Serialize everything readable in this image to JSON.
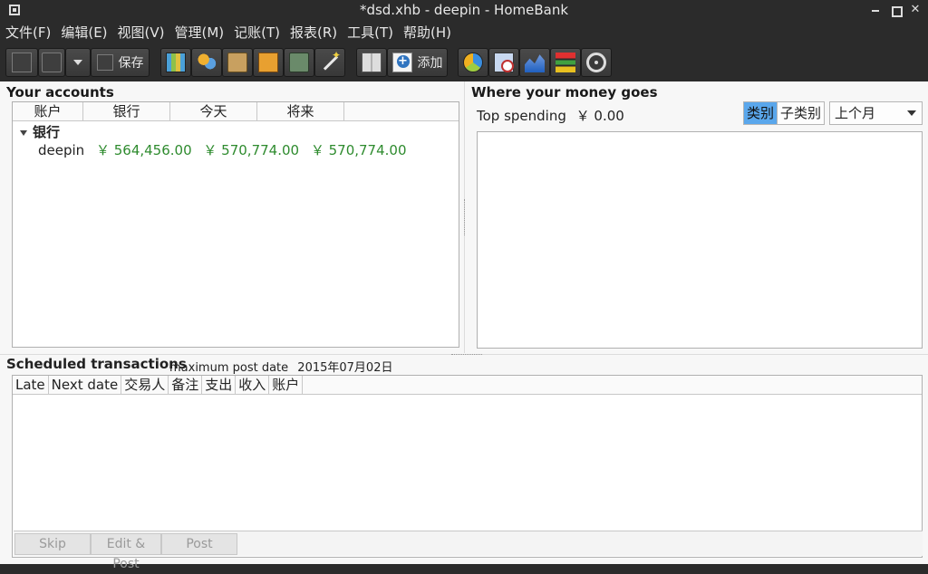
{
  "window": {
    "title": "*dsd.xhb - deepin - HomeBank"
  },
  "menu": [
    "文件(F)",
    "编辑(E)",
    "视图(V)",
    "管理(M)",
    "记账(T)",
    "报表(R)",
    "工具(T)",
    "帮助(H)"
  ],
  "toolbar": {
    "save_label": "保存",
    "add_label": "添加",
    "icons": [
      "new-file-icon",
      "open-folder-icon",
      "dropdown-arrow-icon",
      "save-icon",
      "accounts-icon",
      "payees-icon",
      "categories-icon",
      "budget-icon",
      "archives-icon",
      "wand-icon",
      "ledger-icon",
      "add-transaction-icon",
      "pie-report-icon",
      "balance-report-icon",
      "trend-report-icon",
      "budget-report-icon",
      "vehicle-icon"
    ]
  },
  "accounts": {
    "title": "Your accounts",
    "columns": [
      "账户",
      "银行",
      "今天",
      "将来"
    ],
    "group": "银行",
    "rows": [
      {
        "name": "deepin",
        "bank": "￥ 564,456.00",
        "today": "￥ 570,774.00",
        "future": "￥ 570,774.00"
      }
    ]
  },
  "spending": {
    "title": "Where your money goes",
    "top_label": "Top spending",
    "top_value": "￥ 0.00",
    "tab_category": "类别",
    "tab_subcategory": "子类别",
    "period": "上个月"
  },
  "scheduled": {
    "title": "Scheduled transactions",
    "max_date_label": "maximum post date",
    "max_date_value": "2015年07月02日",
    "columns": [
      "Late",
      "Next date",
      "交易人",
      "备注",
      "支出",
      "收入",
      "账户"
    ],
    "skip_label": "Skip",
    "editpost_label": "Edit & Post",
    "post_label": "Post"
  },
  "colors": {
    "money_positive": "#2e8b2e",
    "accent": "#5aa7ec"
  }
}
